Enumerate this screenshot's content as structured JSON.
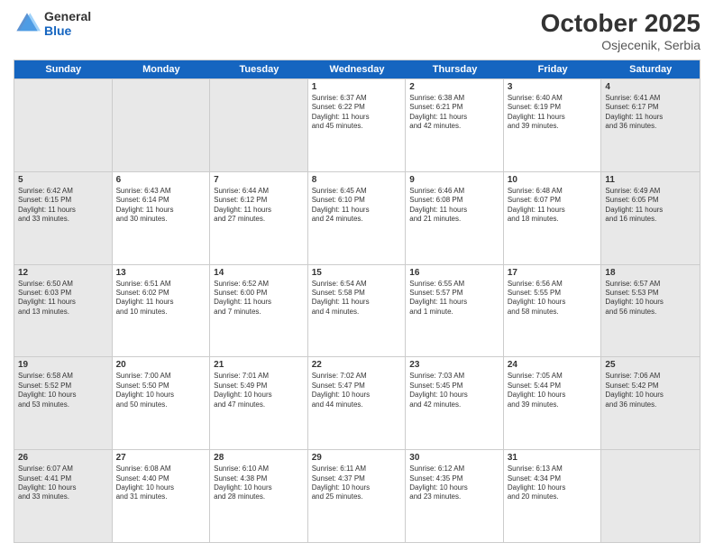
{
  "header": {
    "logo_general": "General",
    "logo_blue": "Blue",
    "month": "October 2025",
    "location": "Osjecenik, Serbia"
  },
  "days_of_week": [
    "Sunday",
    "Monday",
    "Tuesday",
    "Wednesday",
    "Thursday",
    "Friday",
    "Saturday"
  ],
  "weeks": [
    [
      {
        "day": "",
        "info": "",
        "shaded": true
      },
      {
        "day": "",
        "info": "",
        "shaded": true
      },
      {
        "day": "",
        "info": "",
        "shaded": true
      },
      {
        "day": "1",
        "info": "Sunrise: 6:37 AM\nSunset: 6:22 PM\nDaylight: 11 hours\nand 45 minutes.",
        "shaded": false
      },
      {
        "day": "2",
        "info": "Sunrise: 6:38 AM\nSunset: 6:21 PM\nDaylight: 11 hours\nand 42 minutes.",
        "shaded": false
      },
      {
        "day": "3",
        "info": "Sunrise: 6:40 AM\nSunset: 6:19 PM\nDaylight: 11 hours\nand 39 minutes.",
        "shaded": false
      },
      {
        "day": "4",
        "info": "Sunrise: 6:41 AM\nSunset: 6:17 PM\nDaylight: 11 hours\nand 36 minutes.",
        "shaded": true
      }
    ],
    [
      {
        "day": "5",
        "info": "Sunrise: 6:42 AM\nSunset: 6:15 PM\nDaylight: 11 hours\nand 33 minutes.",
        "shaded": true
      },
      {
        "day": "6",
        "info": "Sunrise: 6:43 AM\nSunset: 6:14 PM\nDaylight: 11 hours\nand 30 minutes.",
        "shaded": false
      },
      {
        "day": "7",
        "info": "Sunrise: 6:44 AM\nSunset: 6:12 PM\nDaylight: 11 hours\nand 27 minutes.",
        "shaded": false
      },
      {
        "day": "8",
        "info": "Sunrise: 6:45 AM\nSunset: 6:10 PM\nDaylight: 11 hours\nand 24 minutes.",
        "shaded": false
      },
      {
        "day": "9",
        "info": "Sunrise: 6:46 AM\nSunset: 6:08 PM\nDaylight: 11 hours\nand 21 minutes.",
        "shaded": false
      },
      {
        "day": "10",
        "info": "Sunrise: 6:48 AM\nSunset: 6:07 PM\nDaylight: 11 hours\nand 18 minutes.",
        "shaded": false
      },
      {
        "day": "11",
        "info": "Sunrise: 6:49 AM\nSunset: 6:05 PM\nDaylight: 11 hours\nand 16 minutes.",
        "shaded": true
      }
    ],
    [
      {
        "day": "12",
        "info": "Sunrise: 6:50 AM\nSunset: 6:03 PM\nDaylight: 11 hours\nand 13 minutes.",
        "shaded": true
      },
      {
        "day": "13",
        "info": "Sunrise: 6:51 AM\nSunset: 6:02 PM\nDaylight: 11 hours\nand 10 minutes.",
        "shaded": false
      },
      {
        "day": "14",
        "info": "Sunrise: 6:52 AM\nSunset: 6:00 PM\nDaylight: 11 hours\nand 7 minutes.",
        "shaded": false
      },
      {
        "day": "15",
        "info": "Sunrise: 6:54 AM\nSunset: 5:58 PM\nDaylight: 11 hours\nand 4 minutes.",
        "shaded": false
      },
      {
        "day": "16",
        "info": "Sunrise: 6:55 AM\nSunset: 5:57 PM\nDaylight: 11 hours\nand 1 minute.",
        "shaded": false
      },
      {
        "day": "17",
        "info": "Sunrise: 6:56 AM\nSunset: 5:55 PM\nDaylight: 10 hours\nand 58 minutes.",
        "shaded": false
      },
      {
        "day": "18",
        "info": "Sunrise: 6:57 AM\nSunset: 5:53 PM\nDaylight: 10 hours\nand 56 minutes.",
        "shaded": true
      }
    ],
    [
      {
        "day": "19",
        "info": "Sunrise: 6:58 AM\nSunset: 5:52 PM\nDaylight: 10 hours\nand 53 minutes.",
        "shaded": true
      },
      {
        "day": "20",
        "info": "Sunrise: 7:00 AM\nSunset: 5:50 PM\nDaylight: 10 hours\nand 50 minutes.",
        "shaded": false
      },
      {
        "day": "21",
        "info": "Sunrise: 7:01 AM\nSunset: 5:49 PM\nDaylight: 10 hours\nand 47 minutes.",
        "shaded": false
      },
      {
        "day": "22",
        "info": "Sunrise: 7:02 AM\nSunset: 5:47 PM\nDaylight: 10 hours\nand 44 minutes.",
        "shaded": false
      },
      {
        "day": "23",
        "info": "Sunrise: 7:03 AM\nSunset: 5:45 PM\nDaylight: 10 hours\nand 42 minutes.",
        "shaded": false
      },
      {
        "day": "24",
        "info": "Sunrise: 7:05 AM\nSunset: 5:44 PM\nDaylight: 10 hours\nand 39 minutes.",
        "shaded": false
      },
      {
        "day": "25",
        "info": "Sunrise: 7:06 AM\nSunset: 5:42 PM\nDaylight: 10 hours\nand 36 minutes.",
        "shaded": true
      }
    ],
    [
      {
        "day": "26",
        "info": "Sunrise: 6:07 AM\nSunset: 4:41 PM\nDaylight: 10 hours\nand 33 minutes.",
        "shaded": true
      },
      {
        "day": "27",
        "info": "Sunrise: 6:08 AM\nSunset: 4:40 PM\nDaylight: 10 hours\nand 31 minutes.",
        "shaded": false
      },
      {
        "day": "28",
        "info": "Sunrise: 6:10 AM\nSunset: 4:38 PM\nDaylight: 10 hours\nand 28 minutes.",
        "shaded": false
      },
      {
        "day": "29",
        "info": "Sunrise: 6:11 AM\nSunset: 4:37 PM\nDaylight: 10 hours\nand 25 minutes.",
        "shaded": false
      },
      {
        "day": "30",
        "info": "Sunrise: 6:12 AM\nSunset: 4:35 PM\nDaylight: 10 hours\nand 23 minutes.",
        "shaded": false
      },
      {
        "day": "31",
        "info": "Sunrise: 6:13 AM\nSunset: 4:34 PM\nDaylight: 10 hours\nand 20 minutes.",
        "shaded": false
      },
      {
        "day": "",
        "info": "",
        "shaded": true
      }
    ]
  ]
}
